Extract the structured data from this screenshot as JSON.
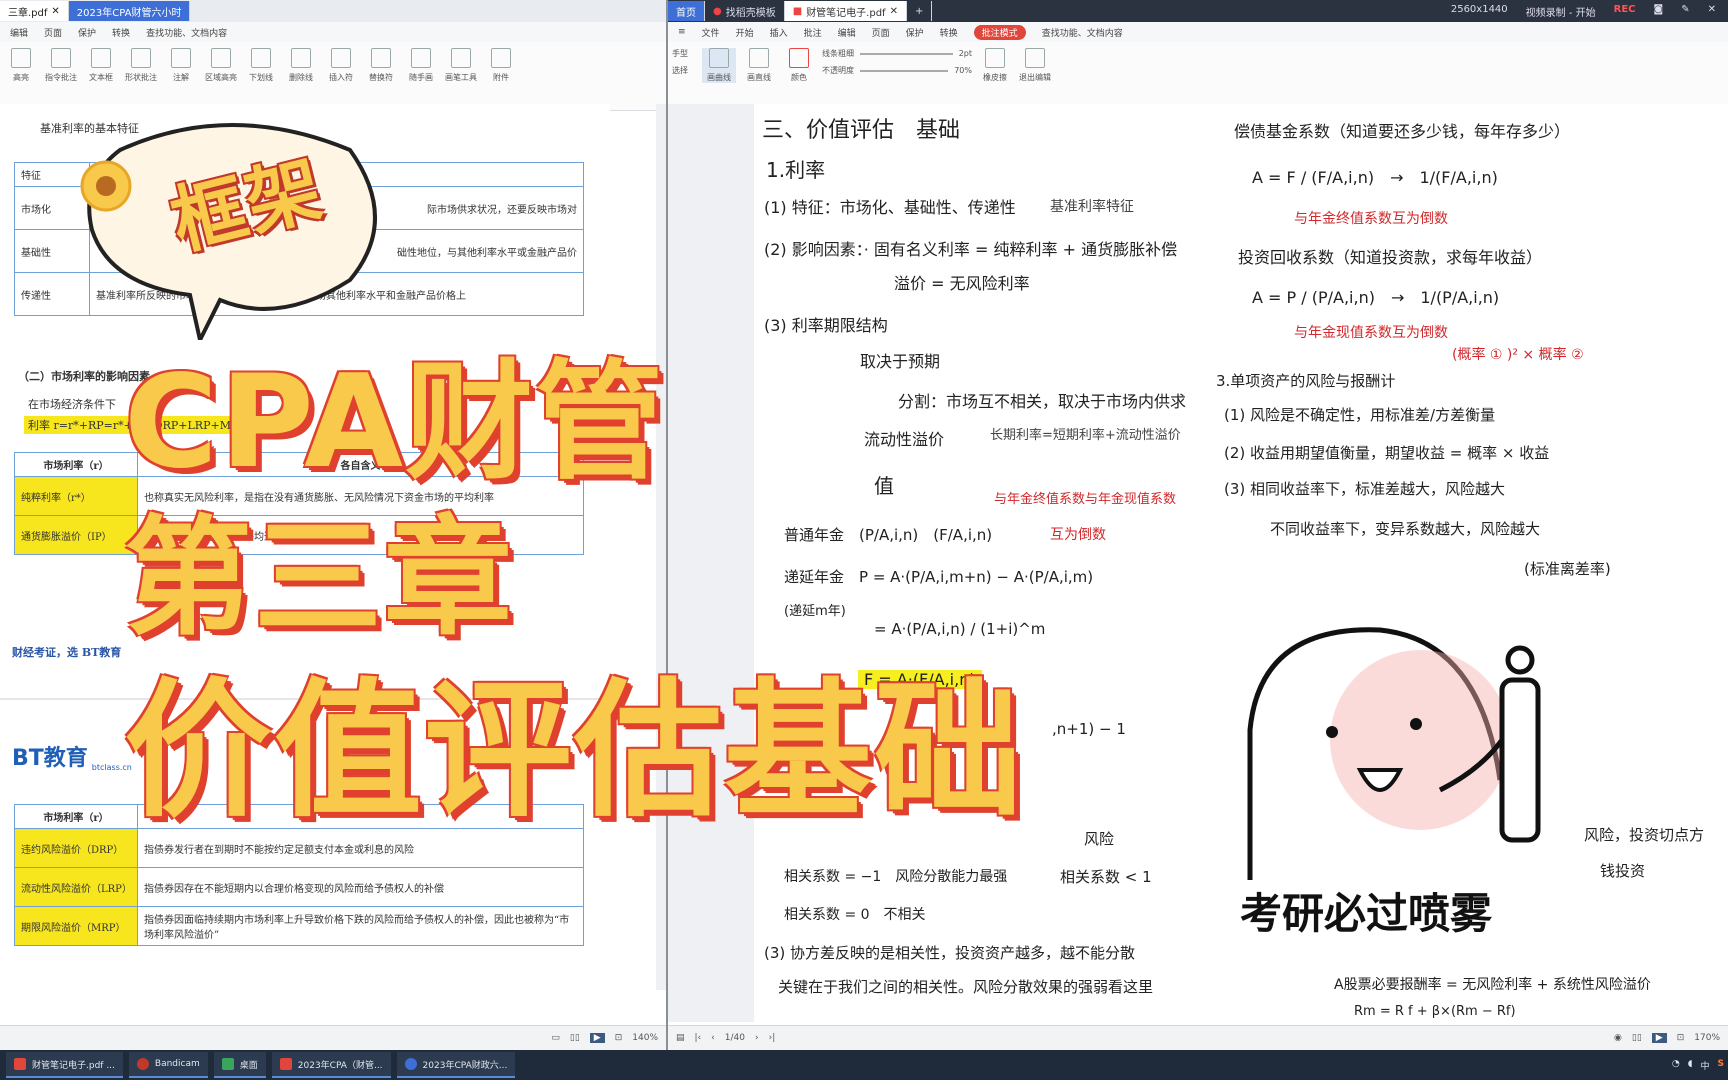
{
  "left_window": {
    "tabs": [
      "三章.pdf",
      "2023年CPA财管六小时"
    ],
    "menu": [
      "编辑",
      "页面",
      "保护",
      "转换",
      "查找功能、文档内容"
    ],
    "ribbon": [
      "高亮",
      "指令批注",
      "文本框",
      "形状批注",
      "注解",
      "区域高亮",
      "下划线",
      "删除线",
      "插入符",
      "替换符",
      "随手画",
      "画笔工具",
      "附件"
    ],
    "intro_text": "基准利率的基本特征",
    "table1_head": [
      "特征",
      ""
    ],
    "table1_rows": [
      {
        "key": "市场化",
        "desc": "际市场供求状况，还要反映市场对"
      },
      {
        "key": "基础性",
        "desc": "础性地位，与其他利率水平或金融产品价"
      },
      {
        "key": "传递性",
        "desc": "基准利率所反映的市场信号，能有效传递到金融市场其他利率水平和金融产品价格上"
      }
    ],
    "section2": "（二）市场利率的影响因素",
    "formula_line1": "在市场经济条件下",
    "formula_line2": "利率 r=r*+RP=r*+IP+DRP+LRP+MRP",
    "table2_head": [
      "市场利率（r）",
      "各自含义"
    ],
    "table2_rows": [
      {
        "key": "纯粹利率（r*）",
        "desc": "也称真实无风险利率，是指在没有通货膨胀、无风险情况下资金市场的平均利率"
      },
      {
        "key": "通货膨胀溢价（IP）",
        "desc": "指证券存续期间预期的平均通货膨胀率"
      }
    ],
    "footer_note": "财经考证，选 BT教育",
    "logo_text": "BT教育",
    "logo_sub": "btclass.cn",
    "table3_head": [
      "市场利率（r）",
      ""
    ],
    "table3_rows": [
      {
        "key": "违约风险溢价（DRP）",
        "desc": "指债券发行者在到期时不能按约定足额支付本金或利息的风险"
      },
      {
        "key": "流动性风险溢价（LRP）",
        "desc": "指债券因存在不能短期内以合理价格变现的风险而给予债权人的补偿"
      },
      {
        "key": "期限风险溢价（MRP）",
        "desc": "指债券因面临持续期内市场利率上升导致价格下跌的风险而给予债权人的补偿，因此也被称为“市场利率风险溢价”"
      }
    ],
    "zoom": "140%"
  },
  "right_window": {
    "tabs": [
      "首页",
      "找稻壳模板",
      "财管笔记电子.pdf"
    ],
    "resolution": "2560x1440",
    "recording": "REC",
    "status_text": "视频录制 - 开始",
    "menu": [
      "文件",
      "开始",
      "插入",
      "批注",
      "编辑",
      "页面",
      "保护",
      "转换",
      "查找功能、文档内容"
    ],
    "menu_highlight": "批注模式",
    "ribbon_left": [
      "手型",
      "选择"
    ],
    "ribbon": [
      "画曲线",
      "画直线",
      "颜色",
      "不透明度",
      "线条粗细",
      "橡皮擦",
      "退出编辑"
    ],
    "pen_size": "2pt",
    "opacity": "70%",
    "page_nav": "1/40",
    "zoom": "170%"
  },
  "notes": {
    "title": "三、价值评估　基础",
    "l1": "1.利率",
    "l2": "(1) 特征：市场化、基础性、传递性",
    "l2b": "基准利率特征",
    "l3": "(2) 影响因素：· 固有名义利率 = 纯粹利率 + 通货膨胀补偿",
    "l4": "溢价 = 无风险利率",
    "l5": "(3) 利率期限结构",
    "l6": "取决于预期",
    "l7": "分割：市场互不相关，取决于市场内供求",
    "l8": "流动性溢价",
    "l8b": "长期利率=短期利率+流动性溢价",
    "l9": "值",
    "l10": "与年金终值系数与年金现值系数",
    "l11": "普通年金　(P/A,i,n)　(F/A,i,n)",
    "l11b": "互为倒数",
    "l12": "递延年金　P = A·(P/A,i,m+n) − A·(P/A,i,m)",
    "l13": "(递延m年)",
    "l14": "= A·(P/A,i,n) / (1+i)^m",
    "l15": "F = A·(F/A,i,n)",
    "l16": ",n+1) − 1",
    "r1": "偿债基金系数（知道要还多少钱，每年存多少）",
    "r2": "A = F / (F/A,i,n)　→　1/(F/A,i,n)",
    "r3": "与年金终值系数互为倒数",
    "r4": "投资回收系数（知道投资款，求每年收益）",
    "r5": "A = P / (P/A,i,n)　→　1/(P/A,i,n)",
    "r6": "与年金现值系数互为倒数",
    "r7": "3.单项资产的风险与报酬计",
    "r7b": "(概率 ① )² × 概率 ②",
    "r8": "(1) 风险是不确定性，用标准差/方差衡量",
    "r9": "(2) 收益用期望值衡量，期望收益 = 概率 × 收益",
    "r10": "(3) 相同收益率下，标准差越大，风险越大",
    "r11": "不同收益率下，变异系数越大，风险越大",
    "r12": "(标准离差率)",
    "b1": "风险",
    "b2": "相关系数 < 1",
    "b3": "相关系数 = −1　风险分散能力最强",
    "b4": "相关系数 = 0　不相关",
    "b5": "(3) 协方差反映的是相关性，投资资产越多，越不能分散",
    "b6": "关键在于我们之间的相关性。风险分散效果的强弱看这里",
    "b7": "A股票必要报酬率 = 无风险利率 + 系统性风险溢价",
    "b8": "风险，投资切点方",
    "b9": "钱投资",
    "b10": "Rm = R f + β×(Rm − Rf)"
  },
  "overlay": {
    "bubble_text": "框架",
    "line1": "CPA财管",
    "line2": "第三章",
    "line3": "价值评估基础",
    "ghost_caption": "考研必过喷雾"
  },
  "taskbar": {
    "items": [
      "财管笔记电子.pdf ...",
      "Bandicam",
      "桌面",
      "2023年CPA（财管...",
      "2023年CPA财政六..."
    ],
    "tray": [
      "中",
      "S"
    ]
  },
  "colors": {
    "title_fill": "#f8c94a",
    "title_outline": "#e0412f",
    "note_red": "#d2282b",
    "table_key_bg": "#f7e61e",
    "tab_blue": "#3d6fd6"
  }
}
